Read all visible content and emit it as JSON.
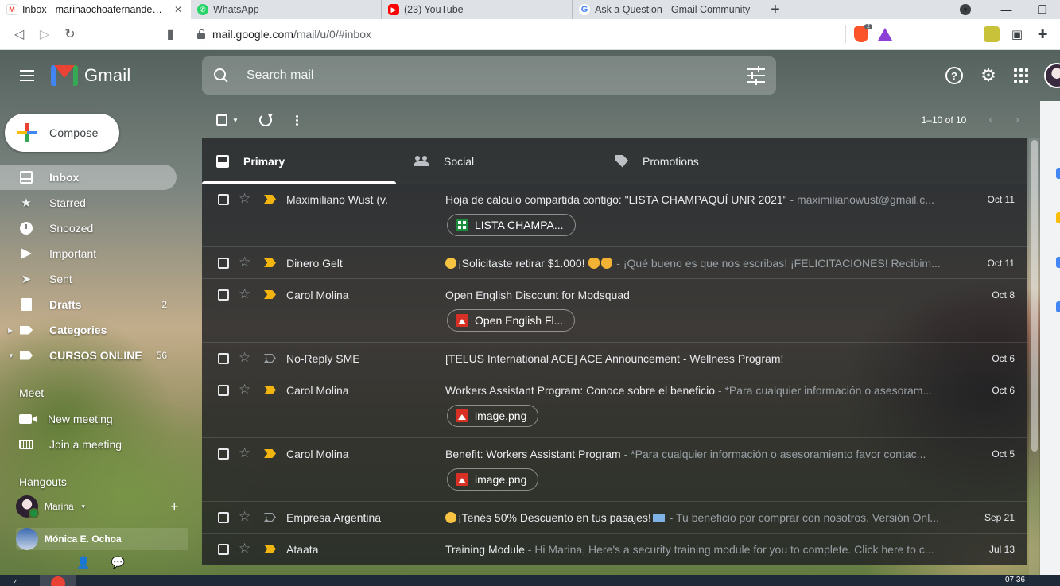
{
  "browser": {
    "tabs": [
      {
        "title": "Inbox - marinaochoafernandez@g",
        "icon": "gmail-icon",
        "active": true
      },
      {
        "title": "WhatsApp",
        "icon": "whatsapp-icon",
        "active": false
      },
      {
        "title": "(23) YouTube",
        "icon": "youtube-icon",
        "active": false
      },
      {
        "title": "Ask a Question - Gmail Community",
        "icon": "google-icon",
        "active": false
      }
    ],
    "new_tab_symbol": "+",
    "url_host": "mail.google.com",
    "url_path": "/mail/u/0/#inbox",
    "brave_badge": "2",
    "colors": {
      "brave_orange": "#fb542b",
      "brave_purple": "#8c3fd6"
    }
  },
  "gmail": {
    "logo_text": "Gmail",
    "search_placeholder": "Search mail",
    "compose_label": "Compose",
    "nav": [
      {
        "label": "Inbox",
        "icon": "inbox-icon",
        "count": "",
        "active": true
      },
      {
        "label": "Starred",
        "icon": "star-icon",
        "count": ""
      },
      {
        "label": "Snoozed",
        "icon": "clock-icon",
        "count": ""
      },
      {
        "label": "Important",
        "icon": "important-icon",
        "count": ""
      },
      {
        "label": "Sent",
        "icon": "send-icon",
        "count": ""
      },
      {
        "label": "Drafts",
        "icon": "draft-icon",
        "count": "2"
      },
      {
        "label": "Categories",
        "icon": "label-icon",
        "count": ""
      },
      {
        "label": "CURSOS ONLINE",
        "icon": "label-icon",
        "count": "56"
      }
    ],
    "meet": {
      "heading": "Meet",
      "items": [
        "New meeting",
        "Join a meeting"
      ]
    },
    "hangouts": {
      "heading": "Hangouts",
      "user": "Marina",
      "contact": "Mónica E. Ochoa"
    },
    "pager": "1–10 of 10",
    "tabs": [
      "Primary",
      "Social",
      "Promotions"
    ],
    "emails": [
      {
        "sender": "Maximiliano Wust (v.",
        "subject": "Hoja de cálculo compartida contigo: \"LISTA CHAMPAQUÍ UNR 2021\"",
        "snippet": " - maximilianowust@gmail.c...",
        "date": "Oct 11",
        "important": true,
        "attachment": "LISTA CHAMPA...",
        "attachment_type": "sheet",
        "emoji": ""
      },
      {
        "sender": "Dinero Gelt",
        "subject": "¡Solicitaste retirar $1.000!",
        "snippet": " - ¡Qué bueno es que nos escribas! ¡FELICITACIONES! Recibim...",
        "date": "Oct 11",
        "important": true,
        "attachment": "",
        "emoji": "party"
      },
      {
        "sender": "Carol Molina",
        "subject": "Open English Discount for Modsquad",
        "snippet": "",
        "date": "Oct 8",
        "important": true,
        "attachment": "Open English Fl...",
        "attachment_type": "image",
        "emoji": ""
      },
      {
        "sender": "No-Reply SME",
        "subject": "[TELUS International ACE] ACE Announcement - Wellness Program!",
        "snippet": "",
        "date": "Oct 6",
        "important": false,
        "attachment": "",
        "emoji": ""
      },
      {
        "sender": "Carol Molina",
        "subject": "Workers Assistant Program: Conoce sobre el beneficio",
        "snippet": " - *Para cualquier información o asesoram...",
        "date": "Oct 6",
        "important": true,
        "attachment": "image.png",
        "attachment_type": "image",
        "emoji": ""
      },
      {
        "sender": "Carol Molina",
        "subject": "Benefit: Workers Assistant Program",
        "snippet": " - *Para cualquier información o asesoramiento favor contac...",
        "date": "Oct 5",
        "important": true,
        "attachment": "image.png",
        "attachment_type": "image",
        "emoji": ""
      },
      {
        "sender": "Empresa Argentina",
        "subject": "¡Tenés 50% Descuento en tus pasajes!",
        "snippet": " - Tu beneficio por comprar con nosotros. Versión Onl...",
        "date": "Sep 21",
        "important": false,
        "attachment": "",
        "emoji": "party-card"
      },
      {
        "sender": "Ataata",
        "subject": "Training Module",
        "snippet": " - Hi Marina, Here's a security training module for you to complete. Click here to c...",
        "date": "Jul 13",
        "important": true,
        "attachment": "",
        "emoji": ""
      }
    ],
    "colors": {
      "important_marker": "#f2b40f",
      "sheet_green": "#1e8e3e",
      "image_red": "#d93025"
    }
  },
  "taskbar": {
    "clock": "07:36"
  }
}
